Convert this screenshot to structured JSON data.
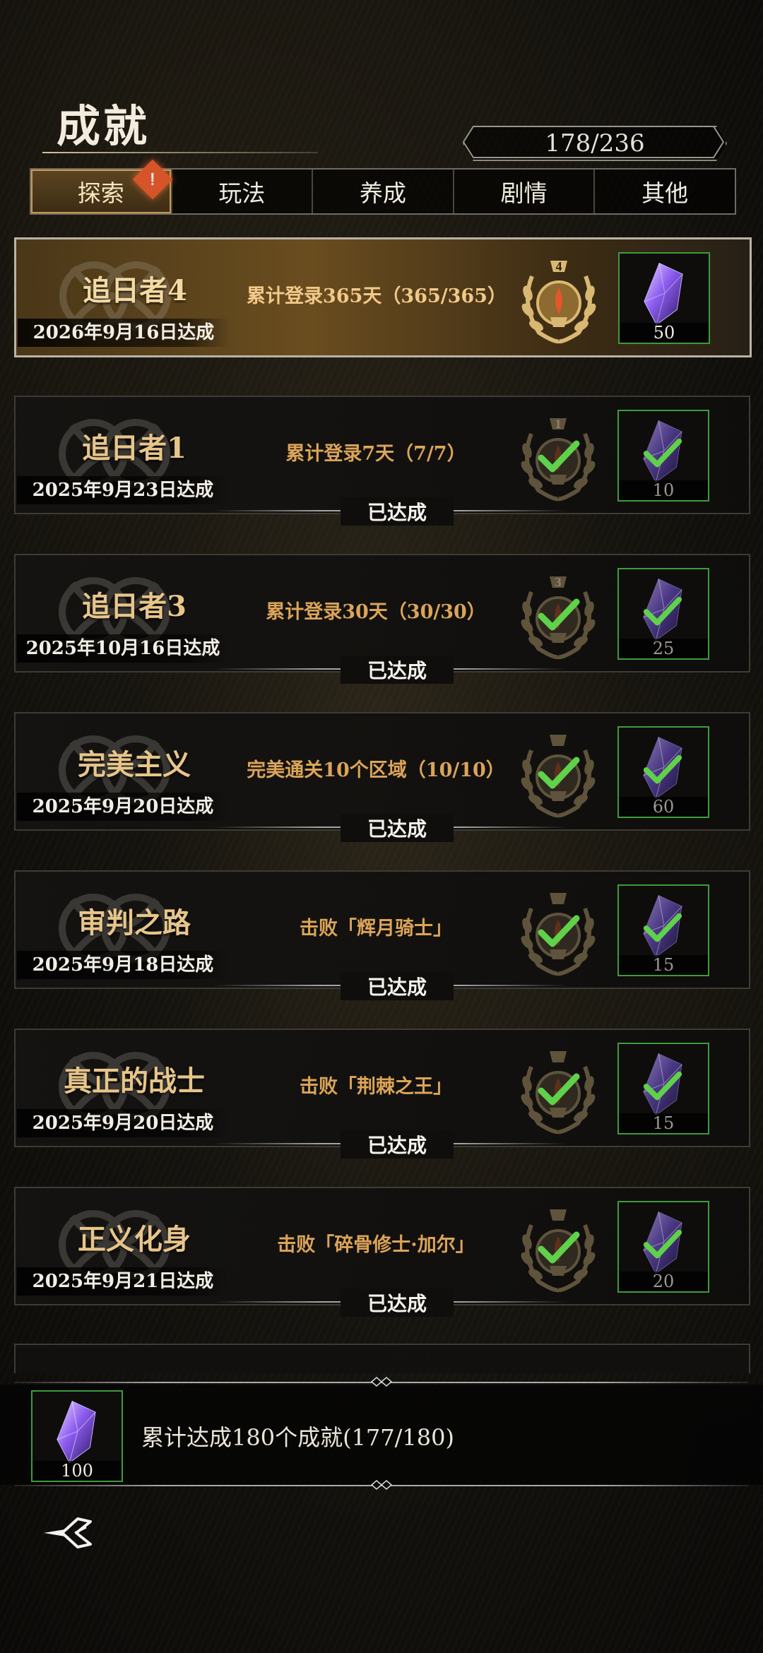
{
  "header": {
    "title": "成就",
    "progress": "178/236"
  },
  "tabs": [
    {
      "label": "探索",
      "active": true
    },
    {
      "label": "玩法",
      "active": false
    },
    {
      "label": "养成",
      "active": false
    },
    {
      "label": "剧情",
      "active": false
    },
    {
      "label": "其他",
      "active": false
    }
  ],
  "achievements": [
    {
      "name": "追日者4",
      "date": "2026年9月16日达成",
      "desc": "累计登录365天（365/365）",
      "medal_number": "4",
      "reward": "50",
      "featured": true,
      "completed_label": ""
    },
    {
      "name": "追日者1",
      "date": "2025年9月23日达成",
      "desc": "累计登录7天（7/7）",
      "medal_number": "1",
      "reward": "10",
      "featured": false,
      "completed_label": "已达成"
    },
    {
      "name": "追日者3",
      "date": "2025年10月16日达成",
      "desc": "累计登录30天（30/30）",
      "medal_number": "3",
      "reward": "25",
      "featured": false,
      "completed_label": "已达成"
    },
    {
      "name": "完美主义",
      "date": "2025年9月20日达成",
      "desc": "完美通关10个区域（10/10）",
      "medal_number": "",
      "reward": "60",
      "featured": false,
      "completed_label": "已达成"
    },
    {
      "name": "审判之路",
      "date": "2025年9月18日达成",
      "desc": "击败「辉月骑士」",
      "medal_number": "",
      "reward": "15",
      "featured": false,
      "completed_label": "已达成"
    },
    {
      "name": "真正的战士",
      "date": "2025年9月20日达成",
      "desc": "击败「荆棘之王」",
      "medal_number": "",
      "reward": "15",
      "featured": false,
      "completed_label": "已达成"
    },
    {
      "name": "正义化身",
      "date": "2025年9月21日达成",
      "desc": "击败「碎骨修士·加尔」",
      "medal_number": "",
      "reward": "20",
      "featured": false,
      "completed_label": "已达成"
    }
  ],
  "summary": {
    "reward": "100",
    "text": "累计达成180个成就(177/180)"
  },
  "colors": {
    "accent_gold": "#dba459",
    "reward_border_green": "#3d9b3a",
    "check_green": "#5fd14a"
  },
  "icons": [
    "crystal-icon",
    "laurel-medal-icon",
    "checkmark-icon",
    "back-arrow-icon"
  ]
}
